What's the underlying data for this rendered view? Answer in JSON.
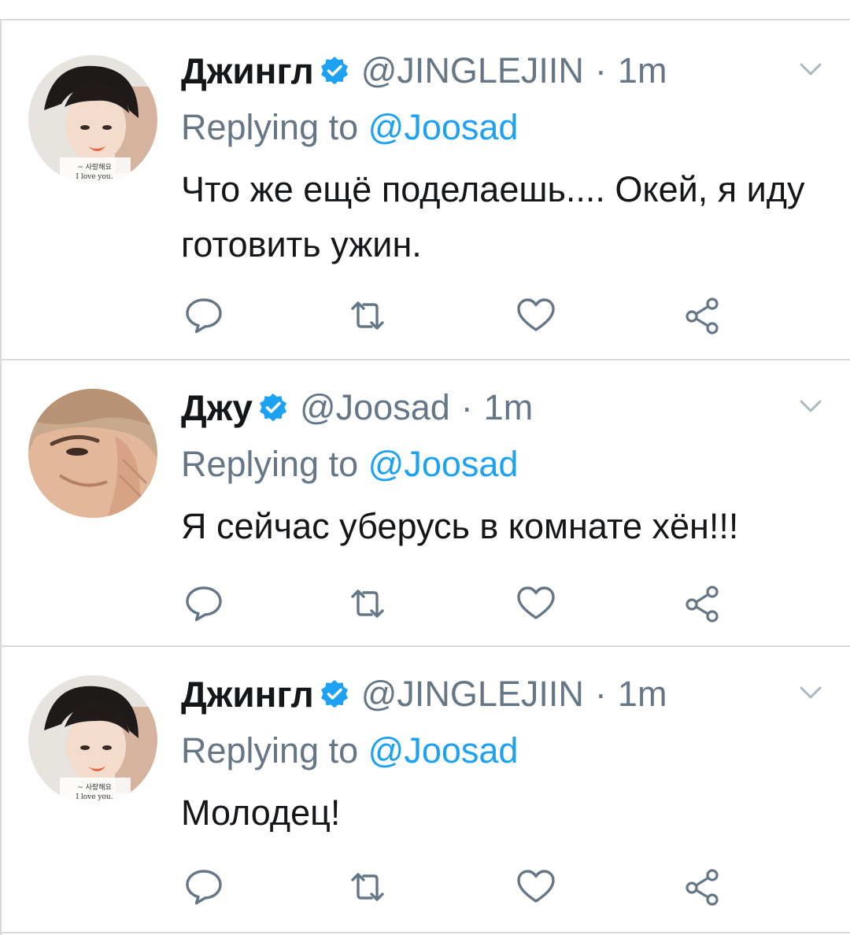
{
  "tweets": [
    {
      "display_name": "Джингл",
      "handle": "@JINGLEJIIN",
      "separator": "·",
      "time": "1m",
      "reply_prefix": "Replying to",
      "reply_to": "@Joosad",
      "text": "Что же ещё поделаешь.... Окей, я иду готовить ужин.",
      "avatar_icon": "avatar-jin"
    },
    {
      "display_name": "Джу",
      "handle": "@Joosad",
      "separator": "·",
      "time": "1m",
      "reply_prefix": "Replying to",
      "reply_to": "@Joosad",
      "text": "Я сейчас уберусь в комнате хён!!!",
      "avatar_icon": "avatar-joo"
    },
    {
      "display_name": "Джингл",
      "handle": "@JINGLEJIIN",
      "separator": "·",
      "time": "1m",
      "reply_prefix": "Replying to",
      "reply_to": "@Joosad",
      "text": "Молодец!",
      "avatar_icon": "avatar-jin"
    }
  ],
  "icons": {
    "verified": "verified-badge-icon",
    "menu": "chevron-down-icon",
    "reply": "reply-icon",
    "retweet": "retweet-icon",
    "like": "heart-icon",
    "share": "share-icon"
  },
  "colors": {
    "accent": "#1da1f2",
    "secondary_text": "#657786",
    "primary_text": "#14171a",
    "border": "#d5d9dd"
  }
}
